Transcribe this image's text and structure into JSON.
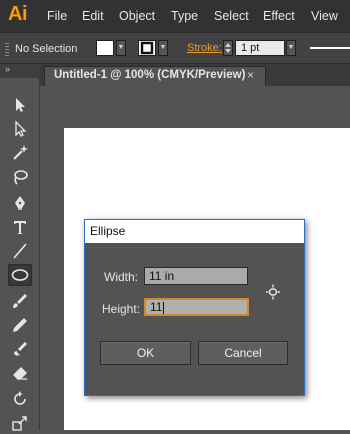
{
  "app": {
    "logo": "Ai"
  },
  "menu": [
    "File",
    "Edit",
    "Object",
    "Type",
    "Select",
    "Effect",
    "View"
  ],
  "controlbar": {
    "selection_text": "No Selection",
    "stroke_label": "Stroke:",
    "stroke_weight": "1 pt"
  },
  "document": {
    "tab_title": "Untitled-1 @ 100% (CMYK/Preview)",
    "close_glyph": "×"
  },
  "tools": [
    {
      "name": "selection-tool-icon"
    },
    {
      "name": "direct-selection-tool-icon"
    },
    {
      "name": "magic-wand-tool-icon"
    },
    {
      "name": "lasso-tool-icon"
    },
    {
      "name": "pen-tool-icon"
    },
    {
      "name": "type-tool-icon"
    },
    {
      "name": "line-segment-tool-icon"
    },
    {
      "name": "ellipse-tool-icon",
      "active": true
    },
    {
      "name": "paintbrush-tool-icon"
    },
    {
      "name": "pencil-tool-icon"
    },
    {
      "name": "blob-brush-tool-icon"
    },
    {
      "name": "eraser-tool-icon"
    },
    {
      "name": "rotate-tool-icon"
    },
    {
      "name": "scale-tool-icon"
    }
  ],
  "dialog": {
    "title": "Ellipse",
    "width_label": "Width:",
    "width_value": "11 in",
    "height_label": "Height:",
    "height_value": "11",
    "ok_label": "OK",
    "cancel_label": "Cancel"
  },
  "colors": {
    "accent": "#ff9a00",
    "stroke_label": "#e89a2c",
    "focus_border": "#d08a2a",
    "dialog_border": "#2a6ec6"
  }
}
